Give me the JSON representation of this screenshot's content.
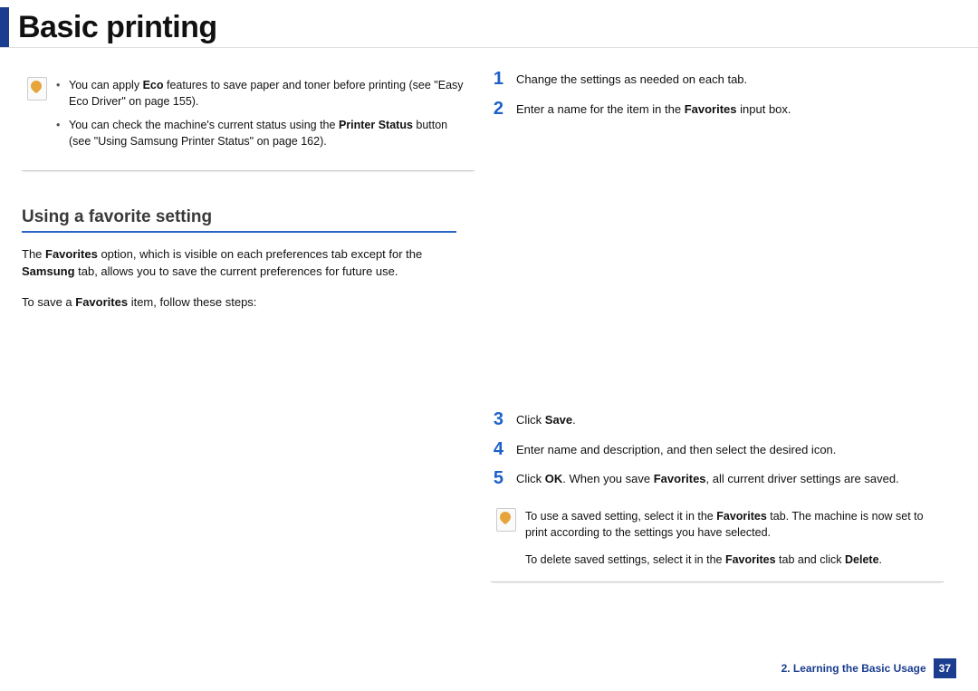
{
  "header": {
    "title": "Basic printing"
  },
  "left": {
    "note_items": [
      "You can apply <b>Eco</b> features to save paper and toner before printing (see \"Easy Eco Driver\" on page 155).",
      "You can check the machine's current status using the <b>Printer Status</b> button (see \"Using Samsung Printer Status\" on page 162)."
    ],
    "section_title": "Using a favorite setting",
    "para1": "The <b>Favorites</b> option, which is visible on each preferences tab except for the <b>Samsung</b> tab, allows you to save the current preferences for future use.",
    "para2": "To save a <b>Favorites</b> item, follow these steps:"
  },
  "right": {
    "steps_a": [
      {
        "n": "1",
        "t": "Change the settings as needed on each tab."
      },
      {
        "n": "2",
        "t": "Enter a name for the item in the <b>Favorites</b> input box."
      }
    ],
    "steps_b": [
      {
        "n": "3",
        "t": "Click <b>Save</b>."
      },
      {
        "n": "4",
        "t": "Enter name and description, and then select the desired icon."
      },
      {
        "n": "5",
        "t": "Click <b>OK</b>. When you save <b>Favorites</b>, all current driver settings are saved."
      }
    ],
    "note_p1": "To use a saved setting, select it in the <b>Favorites</b> tab. The machine is now set to print according to the settings you have selected.",
    "note_p2": "To delete saved settings, select it in the <b>Favorites</b> tab and click <b>Delete</b>."
  },
  "footer": {
    "chapter": "2. Learning the Basic Usage",
    "page": "37"
  }
}
